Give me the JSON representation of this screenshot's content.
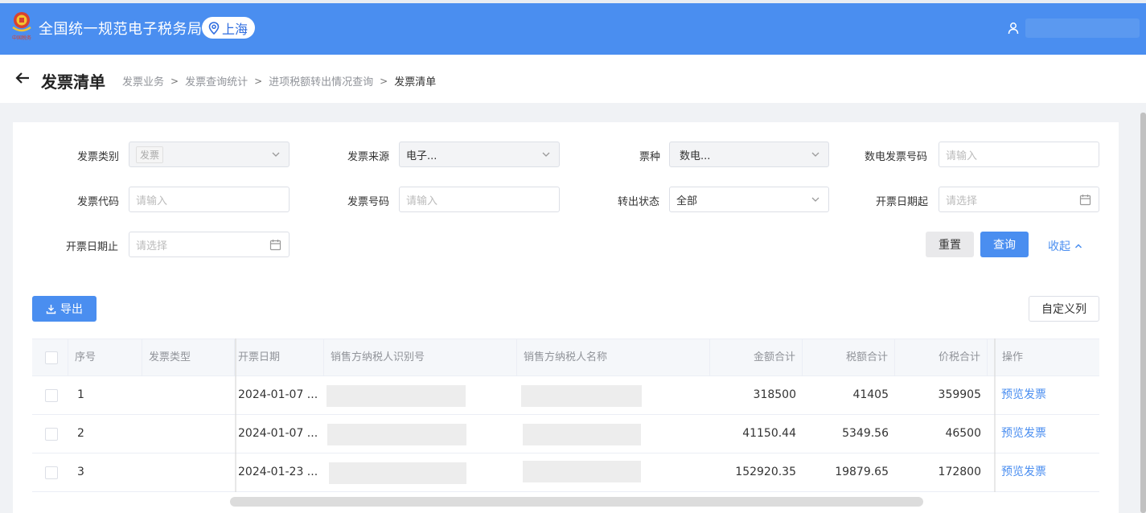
{
  "app": {
    "title": "全国统一规范电子税务局",
    "region": "上海",
    "logo_text": "中国税务"
  },
  "header": {
    "page_title": "发票清单",
    "breadcrumb": [
      "发票业务",
      "发票查询统计",
      "进项税额转出情况查询",
      "发票清单"
    ]
  },
  "filters": {
    "invoice_category": {
      "label": "发票类别",
      "value": "发票"
    },
    "invoice_source": {
      "label": "发票来源",
      "value": "电子..."
    },
    "ticket_type": {
      "label": "票种",
      "value": "数电..."
    },
    "digital_invoice_no": {
      "label": "数电发票号码",
      "placeholder": "请输入"
    },
    "invoice_code": {
      "label": "发票代码",
      "placeholder": "请输入"
    },
    "invoice_no": {
      "label": "发票号码",
      "placeholder": "请输入"
    },
    "transfer_status": {
      "label": "转出状态",
      "value": "全部"
    },
    "date_start": {
      "label": "开票日期起",
      "placeholder": "请选择"
    },
    "date_end": {
      "label": "开票日期止",
      "placeholder": "请选择"
    }
  },
  "actions": {
    "reset": "重置",
    "search": "查询",
    "collapse": "收起",
    "export": "导出",
    "custom_columns": "自定义列"
  },
  "table": {
    "columns": [
      "序号",
      "发票类型",
      "开票日期",
      "销售方纳税人识别号",
      "销售方纳税人名称",
      "金额合计",
      "税额合计",
      "价税合计",
      "操作"
    ],
    "rows": [
      {
        "index": "1",
        "type": "",
        "date": "2024-01-07 ...",
        "amount": "318500",
        "tax": "41405",
        "total": "359905",
        "action": "预览发票"
      },
      {
        "index": "2",
        "type": "",
        "date": "2024-01-07 ...",
        "amount": "41150.44",
        "tax": "5349.56",
        "total": "46500",
        "action": "预览发票"
      },
      {
        "index": "3",
        "type": "",
        "date": "2024-01-23 ...",
        "amount": "152920.35",
        "tax": "19879.65",
        "total": "172800",
        "action": "预览发票"
      }
    ]
  },
  "colors": {
    "primary": "#4a8ef0",
    "link": "#4a8ef0",
    "header_bg": "#4a8ef0"
  }
}
